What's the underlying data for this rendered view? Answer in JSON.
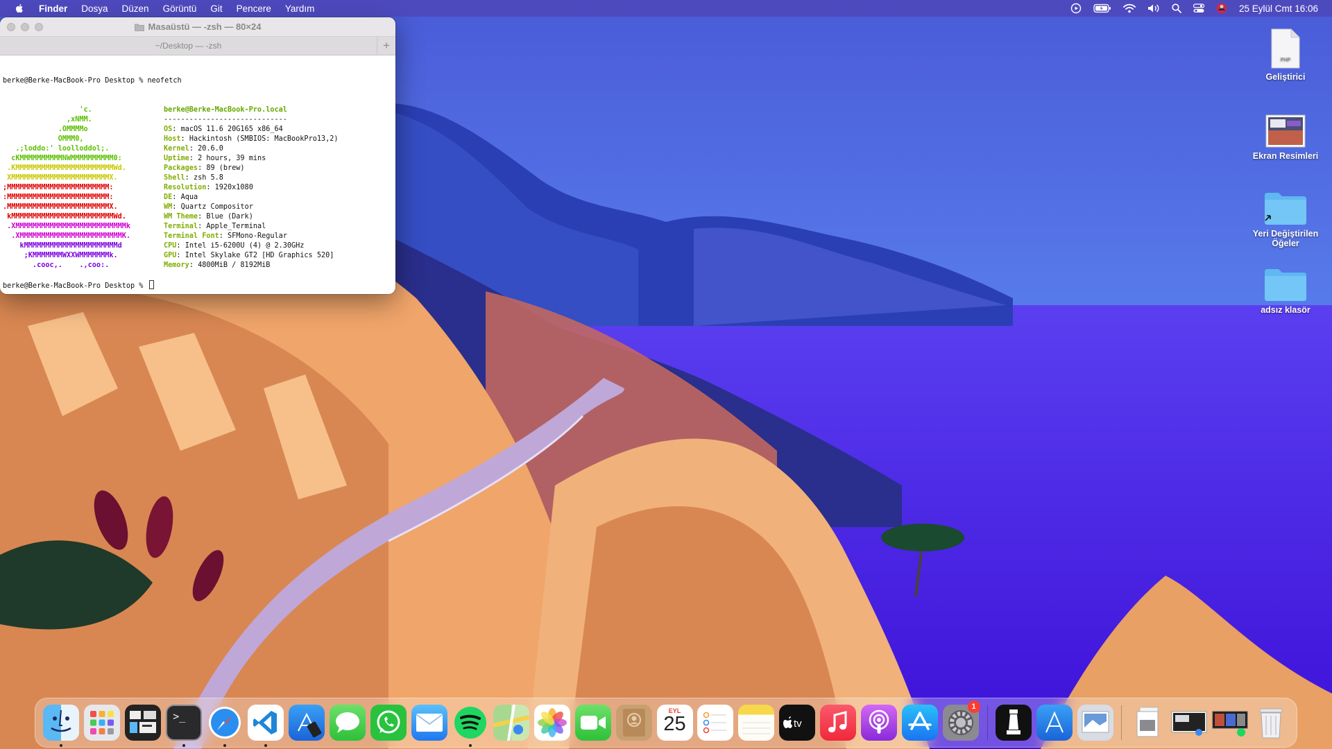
{
  "menubar": {
    "app_name": "Finder",
    "menus": [
      "Dosya",
      "Düzen",
      "Görüntü",
      "Git",
      "Pencere",
      "Yardım"
    ],
    "clock": "25 Eylül Cmt  16:06",
    "status_icons": [
      "screen-record-icon",
      "battery-icon",
      "wifi-icon",
      "volume-icon",
      "spotlight-icon",
      "control-center-icon",
      "user-avatar-icon"
    ]
  },
  "terminal": {
    "window_title": "Masaüstü — -zsh — 80×24",
    "tab_title": "~/Desktop — -zsh",
    "new_tab_label": "+",
    "command_line": "berke@Berke-MacBook-Pro Desktop % neofetch",
    "prompt_line": "berke@Berke-MacBook-Pro Desktop % ",
    "logo_lines": [
      {
        "text": "                  'c.",
        "color": "#5cbf00"
      },
      {
        "text": "               ,xNMM.",
        "color": "#5cbf00"
      },
      {
        "text": "             .OMMMMo",
        "color": "#5cbf00"
      },
      {
        "text": "             OMMM0,",
        "color": "#5cbf00"
      },
      {
        "text": "   .;loddo:' loolloddol;.",
        "color": "#5cbf00"
      },
      {
        "text": "  cKMMMMMMMMMMNWMMMMMMMMMM0:",
        "color": "#5cbf00"
      },
      {
        "text": " .KMMMMMMMMMMMMMMMMMMMMMMMWd.",
        "color": "#c8c800"
      },
      {
        "text": " XMMMMMMMMMMMMMMMMMMMMMMMX.",
        "color": "#c8c800"
      },
      {
        "text": ";MMMMMMMMMMMMMMMMMMMMMMMM:",
        "color": "#e00000"
      },
      {
        "text": ":MMMMMMMMMMMMMMMMMMMMMMMM:",
        "color": "#e00000"
      },
      {
        "text": ".MMMMMMMMMMMMMMMMMMMMMMMMX.",
        "color": "#e00000"
      },
      {
        "text": " kMMMMMMMMMMMMMMMMMMMMMMMMWd.",
        "color": "#e00000"
      },
      {
        "text": " .XMMMMMMMMMMMMMMMMMMMMMMMMMMk",
        "color": "#d000d0"
      },
      {
        "text": "  .XMMMMMMMMMMMMMMMMMMMMMMMMK.",
        "color": "#d000d0"
      },
      {
        "text": "    kMMMMMMMMMMMMMMMMMMMMMMd",
        "color": "#7c00e0"
      },
      {
        "text": "     ;KMMMMMMMWXXWMMMMMMMk.",
        "color": "#7c00e0"
      },
      {
        "text": "       .cooc,.    .,coo:.",
        "color": "#7c00e0"
      }
    ],
    "info_header": "berke@Berke-MacBook-Pro.local",
    "info_rule": "-----------------------------",
    "info": [
      {
        "label": "OS",
        "value": "macOS 11.6 20G165 x86_64"
      },
      {
        "label": "Host",
        "value": "Hackintosh (SMBIOS: MacBookPro13,2)"
      },
      {
        "label": "Kernel",
        "value": "20.6.0"
      },
      {
        "label": "Uptime",
        "value": "2 hours, 39 mins"
      },
      {
        "label": "Packages",
        "value": "89 (brew)"
      },
      {
        "label": "Shell",
        "value": "zsh 5.8"
      },
      {
        "label": "Resolution",
        "value": "1920x1080"
      },
      {
        "label": "DE",
        "value": "Aqua"
      },
      {
        "label": "WM",
        "value": "Quartz Compositor"
      },
      {
        "label": "WM Theme",
        "value": "Blue (Dark)"
      },
      {
        "label": "Terminal",
        "value": "Apple_Terminal"
      },
      {
        "label": "Terminal Font",
        "value": "SFMono-Regular"
      },
      {
        "label": "CPU",
        "value": "Intel i5-6200U (4) @ 2.30GHz"
      },
      {
        "label": "GPU",
        "value": "Intel Skylake GT2 [HD Graphics 520]"
      },
      {
        "label": "Memory",
        "value": "4800MiB / 8192MiB"
      }
    ],
    "palette_top": [
      "#000000",
      "#b00000",
      "#00b000",
      "#a8a800",
      "#5000e0",
      "#d000d0",
      "#00a8b8",
      "#c8c8c8"
    ],
    "palette_bottom": [
      "#6a6a6a",
      "#ff0000",
      "#00e000",
      "#e8e800",
      "#6a00ff",
      "#ff00ff",
      "#00e0f0",
      "#f4f4f4"
    ]
  },
  "desktop_icons": [
    {
      "label": "Geliştirici",
      "icon": "php-file-icon"
    },
    {
      "label": "Ekran Resimleri",
      "icon": "screenshots-thumbnail-icon"
    },
    {
      "label": "Yeri Değiştirilen Öğeler",
      "icon": "folder-alias-icon"
    },
    {
      "label": "adsız klasör",
      "icon": "folder-icon"
    }
  ],
  "dock": {
    "apps": [
      {
        "name": "Finder",
        "icon": "finder-icon",
        "running": true
      },
      {
        "name": "Launchpad",
        "icon": "launchpad-icon",
        "running": false
      },
      {
        "name": "Mission Control",
        "icon": "mission-control-icon",
        "running": false
      },
      {
        "name": "Terminal",
        "icon": "terminal-icon",
        "running": true
      },
      {
        "name": "Safari",
        "icon": "safari-icon",
        "running": true
      },
      {
        "name": "Visual Studio Code",
        "icon": "vscode-icon",
        "running": true
      },
      {
        "name": "Xcode",
        "icon": "xcode-icon",
        "running": false
      },
      {
        "name": "Messages",
        "icon": "messages-icon",
        "running": false
      },
      {
        "name": "WhatsApp",
        "icon": "whatsapp-icon",
        "running": false
      },
      {
        "name": "Mail",
        "icon": "mail-icon",
        "running": false
      },
      {
        "name": "Spotify",
        "icon": "spotify-icon",
        "running": true
      },
      {
        "name": "Maps",
        "icon": "maps-icon",
        "running": false
      },
      {
        "name": "Photos",
        "icon": "photos-icon",
        "running": false
      },
      {
        "name": "FaceTime",
        "icon": "facetime-icon",
        "running": false
      },
      {
        "name": "Contacts",
        "icon": "contacts-icon",
        "running": false
      },
      {
        "name": "Calendar",
        "icon": "calendar-icon",
        "running": false,
        "month": "EYL",
        "day": "25"
      },
      {
        "name": "Reminders",
        "icon": "reminders-icon",
        "running": false
      },
      {
        "name": "Notes",
        "icon": "notes-icon",
        "running": false
      },
      {
        "name": "TV",
        "icon": "tv-icon",
        "running": false,
        "text": "tv"
      },
      {
        "name": "Music",
        "icon": "music-icon",
        "running": false
      },
      {
        "name": "Podcasts",
        "icon": "podcasts-icon",
        "running": false
      },
      {
        "name": "App Store",
        "icon": "app-store-icon",
        "running": false
      },
      {
        "name": "System Preferences",
        "icon": "system-preferences-icon",
        "running": false,
        "badge": "1"
      }
    ],
    "utilities": [
      {
        "name": "Chess",
        "icon": "chess-icon"
      },
      {
        "name": "Xcode Instruments",
        "icon": "instruments-icon"
      },
      {
        "name": "Preview",
        "icon": "preview-icon"
      }
    ],
    "stacks": [
      {
        "name": "Documents stack",
        "icon": "documents-stack-icon"
      },
      {
        "name": "Screenshots stack",
        "icon": "screenshots-stack-icon"
      },
      {
        "name": "Downloads stack",
        "icon": "downloads-stack-icon"
      },
      {
        "name": "Trash",
        "icon": "trash-icon"
      }
    ]
  }
}
